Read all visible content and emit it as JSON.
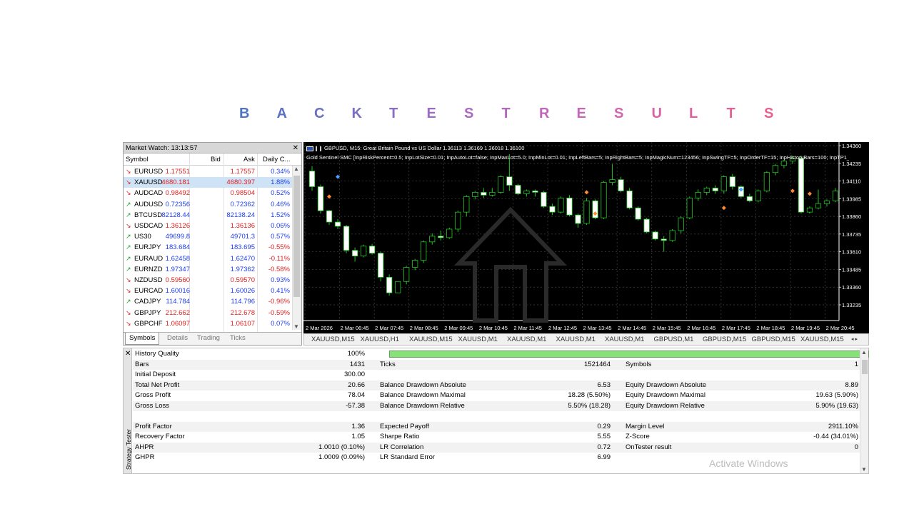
{
  "title": {
    "letters": [
      "B",
      "A",
      "C",
      "K",
      "T",
      "E",
      "S",
      "T",
      "R",
      "E",
      "S",
      "U",
      "L",
      "T",
      "S"
    ],
    "colors": [
      "#4f74c2",
      "#5b72c4",
      "#6a70c4",
      "#7a6fc6",
      "#8a6dc6",
      "#9b6bc6",
      "#aa69c4",
      "#b567c0",
      "#c066bb",
      "#c965b6",
      "#d164ae",
      "#d863a5",
      "#df629d",
      "#e46195",
      "#e8608c"
    ]
  },
  "market_watch": {
    "title": "Market Watch: 13:13:57",
    "headers": {
      "symbol": "Symbol",
      "bid": "Bid",
      "ask": "Ask",
      "change": "Daily C..."
    },
    "rows": [
      {
        "dir": "down",
        "symbol": "EURUSD",
        "bid": "1.17551",
        "ask": "1.17557",
        "change": "0.34%",
        "color": "#e0201f",
        "chg_color": "#1f3ff0"
      },
      {
        "dir": "down",
        "symbol": "XAUUSD",
        "bid": "4680.181",
        "ask": "4680.397",
        "change": "1.88%",
        "color": "#e0201f",
        "chg_color": "#1f3ff0",
        "selected": true
      },
      {
        "dir": "down",
        "symbol": "AUDCAD",
        "bid": "0.98492",
        "ask": "0.98504",
        "change": "0.52%",
        "color": "#e0201f",
        "chg_color": "#1f3ff0"
      },
      {
        "dir": "up",
        "symbol": "AUDUSD",
        "bid": "0.72356",
        "ask": "0.72362",
        "change": "0.46%",
        "color": "#1f3ff0",
        "chg_color": "#1f3ff0"
      },
      {
        "dir": "up",
        "symbol": "BTCUSD",
        "bid": "82128.44",
        "ask": "82138.24",
        "change": "1.52%",
        "color": "#1f3ff0",
        "chg_color": "#1f3ff0"
      },
      {
        "dir": "down",
        "symbol": "USDCAD",
        "bid": "1.36126",
        "ask": "1.36136",
        "change": "0.06%",
        "color": "#e0201f",
        "chg_color": "#1f3ff0"
      },
      {
        "dir": "up",
        "symbol": "US30",
        "bid": "49699.8",
        "ask": "49701.3",
        "change": "0.57%",
        "color": "#1f3ff0",
        "chg_color": "#1f3ff0"
      },
      {
        "dir": "up",
        "symbol": "EURJPY",
        "bid": "183.684",
        "ask": "183.695",
        "change": "-0.55%",
        "color": "#1f3ff0",
        "chg_color": "#e0201f"
      },
      {
        "dir": "up",
        "symbol": "EURAUD",
        "bid": "1.62458",
        "ask": "1.62470",
        "change": "-0.11%",
        "color": "#1f3ff0",
        "chg_color": "#e0201f"
      },
      {
        "dir": "up",
        "symbol": "EURNZD",
        "bid": "1.97347",
        "ask": "1.97362",
        "change": "-0.58%",
        "color": "#1f3ff0",
        "chg_color": "#e0201f"
      },
      {
        "dir": "down",
        "symbol": "NZDUSD",
        "bid": "0.59560",
        "ask": "0.59570",
        "change": "0.93%",
        "color": "#e0201f",
        "chg_color": "#1f3ff0"
      },
      {
        "dir": "down",
        "symbol": "EURCAD",
        "bid": "1.60016",
        "ask": "1.60026",
        "change": "0.41%",
        "color": "#1f3ff0",
        "chg_color": "#1f3ff0"
      },
      {
        "dir": "up",
        "symbol": "CADJPY",
        "bid": "114.784",
        "ask": "114.796",
        "change": "-0.96%",
        "color": "#1f3ff0",
        "chg_color": "#e0201f"
      },
      {
        "dir": "down",
        "symbol": "GBPJPY",
        "bid": "212.662",
        "ask": "212.678",
        "change": "-0.59%",
        "color": "#e0201f",
        "chg_color": "#e0201f"
      },
      {
        "dir": "down",
        "symbol": "GBPCHF",
        "bid": "1.06097",
        "ask": "1.06107",
        "change": "0.07%",
        "color": "#e0201f",
        "chg_color": "#1f3ff0"
      }
    ],
    "tabs": [
      "Symbols",
      "Details",
      "Trading",
      "Ticks"
    ]
  },
  "chart": {
    "info_line1": "GBPUSD, M15:  Great Britain Pound vs US Dollar  1.36113 1.36169 1.36018 1.36100",
    "info_line2": "Gold Sentinel SMC [InpRiskPercent=0.5; InpLotSize=0.01; InpAutoLot=false; InpMaxLot=5.0; InpMinLot=0.01; InpLeftBars=5; InpRightBars=5; InpMagicNum=123456; InpSwingTF=5; InpOrderTF=15; InpHistoryBars=100; InpTP1_F",
    "price_labels": [
      "1.34360",
      "1.34235",
      "1.34110",
      "1.33985",
      "1.33860",
      "1.33735",
      "1.33610",
      "1.33485",
      "1.33360",
      "1.33235"
    ],
    "time_labels": [
      "2 Mar 2026",
      "2 Mar 06:45",
      "2 Mar 07:45",
      "2 Mar 08:45",
      "2 Mar 09:45",
      "2 Mar 10:45",
      "2 Mar 11:45",
      "2 Mar 12:45",
      "2 Mar 13:45",
      "2 Mar 14:45",
      "2 Mar 15:45",
      "2 Mar 16:45",
      "2 Mar 17:45",
      "2 Mar 18:45",
      "2 Mar 19:45",
      "2 Mar 20:45"
    ],
    "tabs": [
      "XAUUSD,M15",
      "XAUUSD,H1",
      "XAUUSD,M15",
      "XAUUSD,M1",
      "XAUUSD,M1",
      "XAUUSD,M1",
      "XAUUSD,M1",
      "GBPUSD,M1",
      "GBPUSD,M15",
      "GBPUSD,M15",
      "XAUUSD,M15"
    ]
  },
  "chart_data": {
    "type": "candlestick",
    "candles": [
      [
        1.3418,
        1.34215,
        1.3404,
        1.3407
      ],
      [
        1.3407,
        1.34085,
        1.3388,
        1.339
      ],
      [
        1.339,
        1.33905,
        1.338,
        1.3382
      ],
      [
        1.3382,
        1.3384,
        1.3377,
        1.3379
      ],
      [
        1.3379,
        1.338,
        1.336,
        1.3362
      ],
      [
        1.3362,
        1.3364,
        1.3354,
        1.3358
      ],
      [
        1.3358,
        1.3366,
        1.3357,
        1.3365
      ],
      [
        1.3365,
        1.33665,
        1.3359,
        1.336
      ],
      [
        1.336,
        1.3361,
        1.334,
        1.3343
      ],
      [
        1.3343,
        1.3345,
        1.333,
        1.3332
      ],
      [
        1.3332,
        1.3324,
        1.3324,
        1.334
      ],
      [
        1.334,
        1.3351,
        1.3338,
        1.335
      ],
      [
        1.335,
        1.3356,
        1.3348,
        1.3355
      ],
      [
        1.3355,
        1.3369,
        1.3353,
        1.3368
      ],
      [
        1.3368,
        1.3374,
        1.3366,
        1.3372
      ],
      [
        1.3372,
        1.3376,
        1.3369,
        1.3371
      ],
      [
        1.3371,
        1.3378,
        1.337,
        1.3377
      ],
      [
        1.3377,
        1.339,
        1.3375,
        1.3389
      ],
      [
        1.3389,
        1.3401,
        1.3386,
        1.34
      ],
      [
        1.34,
        1.3404,
        1.3398,
        1.3403
      ],
      [
        1.3403,
        1.3406,
        1.3399,
        1.3401
      ],
      [
        1.3401,
        1.3406,
        1.34,
        1.3403
      ],
      [
        1.3403,
        1.3415,
        1.3402,
        1.3414
      ],
      [
        1.3414,
        1.343,
        1.3404,
        1.3408
      ],
      [
        1.3408,
        1.3409,
        1.3401,
        1.3402
      ],
      [
        1.3402,
        1.3405,
        1.34,
        1.3404
      ],
      [
        1.3404,
        1.3405,
        1.34,
        1.3403
      ],
      [
        1.3403,
        1.3404,
        1.3392,
        1.3393
      ],
      [
        1.3393,
        1.3395,
        1.3387,
        1.3389
      ],
      [
        1.3389,
        1.34,
        1.3388,
        1.3399
      ],
      [
        1.3399,
        1.3401,
        1.3386,
        1.3387
      ],
      [
        1.3387,
        1.3388,
        1.3378,
        1.3381
      ],
      [
        1.3381,
        1.3399,
        1.338,
        1.3397
      ],
      [
        1.3397,
        1.3398,
        1.3384,
        1.3385
      ],
      [
        1.3385,
        1.3411,
        1.3384,
        1.341
      ],
      [
        1.341,
        1.3423,
        1.3408,
        1.3412
      ],
      [
        1.3412,
        1.3414,
        1.3403,
        1.3404
      ],
      [
        1.3404,
        1.3406,
        1.3391,
        1.3392
      ],
      [
        1.3392,
        1.3393,
        1.3383,
        1.3384
      ],
      [
        1.3384,
        1.3385,
        1.3374,
        1.3375
      ],
      [
        1.3375,
        1.3376,
        1.3369,
        1.337
      ],
      [
        1.337,
        1.3372,
        1.3361,
        1.3369
      ],
      [
        1.3369,
        1.3377,
        1.3368,
        1.3376
      ],
      [
        1.3376,
        1.3386,
        1.3374,
        1.3385
      ],
      [
        1.3385,
        1.34,
        1.3384,
        1.3399
      ],
      [
        1.3399,
        1.3405,
        1.3397,
        1.3403
      ],
      [
        1.3403,
        1.3407,
        1.3401,
        1.3406
      ],
      [
        1.3406,
        1.3408,
        1.3402,
        1.3404
      ],
      [
        1.3404,
        1.3415,
        1.3402,
        1.3414
      ],
      [
        1.3414,
        1.3416,
        1.3405,
        1.3407
      ],
      [
        1.3407,
        1.3408,
        1.3399,
        1.34
      ],
      [
        1.34,
        1.3402,
        1.3396,
        1.3397
      ],
      [
        1.3397,
        1.3405,
        1.3396,
        1.3404
      ],
      [
        1.3404,
        1.3418,
        1.3403,
        1.3417
      ],
      [
        1.3417,
        1.3423,
        1.3415,
        1.3422
      ],
      [
        1.3422,
        1.3426,
        1.342,
        1.3425
      ],
      [
        1.3425,
        1.3429,
        1.3423,
        1.3427
      ],
      [
        1.3427,
        1.3429,
        1.3388,
        1.3389
      ],
      [
        1.3389,
        1.3393,
        1.3388,
        1.3392
      ],
      [
        1.3392,
        1.3405,
        1.3391,
        1.3395
      ],
      [
        1.3395,
        1.3398,
        1.3393,
        1.3397
      ],
      [
        1.3397,
        1.3406,
        1.3396,
        1.3404
      ]
    ]
  },
  "tester": {
    "side_label": "Strategy Tester",
    "rows": [
      {
        "c1": "History Quality",
        "v1": "100%",
        "bar": true
      },
      {
        "c1": "Bars",
        "v1": "1431",
        "c2": "Ticks",
        "v2": "1521464",
        "c3": "Symbols",
        "v3": "1"
      },
      {
        "c1": "Initial Deposit",
        "v1": "300.00"
      },
      {
        "c1": "Total Net Profit",
        "v1": "20.66",
        "c2": "Balance Drawdown Absolute",
        "v2": "6.53",
        "c3": "Equity Drawdown Absolute",
        "v3": "8.89"
      },
      {
        "c1": "Gross Profit",
        "v1": "78.04",
        "c2": "Balance Drawdown Maximal",
        "v2": "18.28 (5.50%)",
        "c3": "Equity Drawdown Maximal",
        "v3": "19.63 (5.90%)"
      },
      {
        "c1": "Gross Loss",
        "v1": "-57.38",
        "c2": "Balance Drawdown Relative",
        "v2": "5.50% (18.28)",
        "c3": "Equity Drawdown Relative",
        "v3": "5.90% (19.63)"
      },
      {},
      {
        "c1": "Profit Factor",
        "v1": "1.36",
        "c2": "Expected Payoff",
        "v2": "0.29",
        "c3": "Margin Level",
        "v3": "2911.10%"
      },
      {
        "c1": "Recovery Factor",
        "v1": "1.05",
        "c2": "Sharpe Ratio",
        "v2": "5.55",
        "c3": "Z-Score",
        "v3": "-0.44 (34.01%)"
      },
      {
        "c1": "AHPR",
        "v1": "1.0010 (0.10%)",
        "c2": "LR Correlation",
        "v2": "0.72",
        "c3": "OnTester result",
        "v3": "0"
      },
      {
        "c1": "GHPR",
        "v1": "1.0009 (0.09%)",
        "c2": "LR Standard Error",
        "v2": "6.99"
      }
    ]
  },
  "watermark": "Activate Windows"
}
